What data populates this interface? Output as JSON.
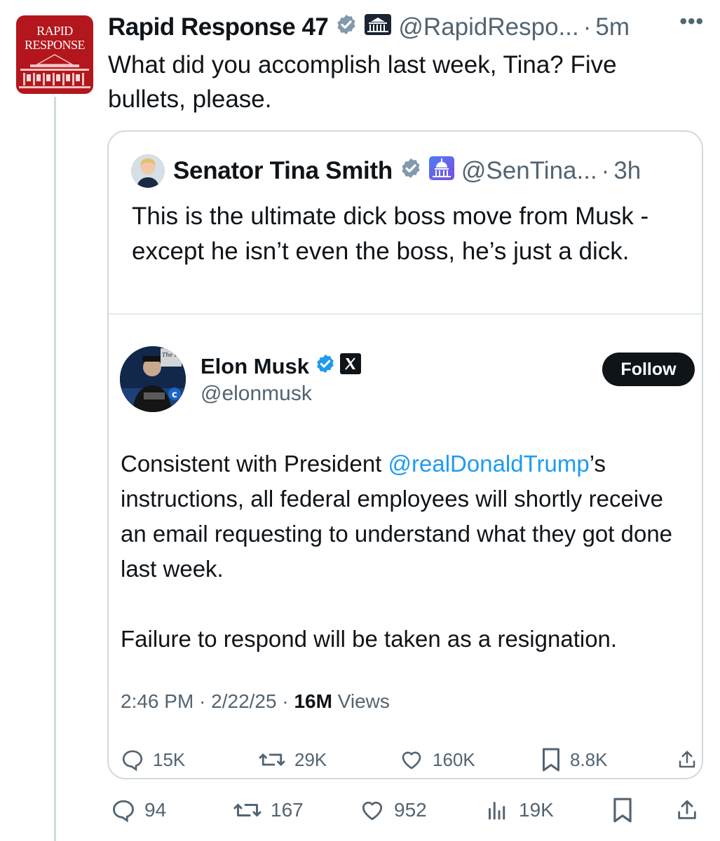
{
  "main_tweet": {
    "avatar_text": [
      "RAPID",
      "RESPONSE"
    ],
    "name": "Rapid Response 47",
    "handle": "@RapidRespo...",
    "time": "5m",
    "text": "What did you accomplish last week, Tina? Five bullets, please.",
    "badges": [
      "verified-badge-icon",
      "white-house-icon"
    ],
    "stats": {
      "replies": "94",
      "reposts": "167",
      "likes": "952",
      "views": "19K"
    }
  },
  "quote": {
    "name": "Senator Tina Smith",
    "handle": "@SenTina...",
    "time": "3h",
    "badges": [
      "verified-badge-icon",
      "capitol-icon"
    ],
    "text": "This is the ultimate dick boss move from Musk - except he isn’t even the boss, he’s just a dick."
  },
  "embedded": {
    "name": "Elon Musk",
    "handle": "@elonmusk",
    "follow_label": "Follow",
    "avatar_text": "The Rogers",
    "body_p1_pre": "Consistent with President ",
    "body_mention": "@realDonaldTrump",
    "body_p1_post": "’s instructions, all federal employees will shortly receive an email requesting to understand what they got done last week.",
    "body_p2": "Failure to respond will be taken as a resignation.",
    "meta_time": "2:46 PM · 2/22/25 · ",
    "meta_views": "16M",
    "meta_views_label": " Views",
    "stats": {
      "replies": "15K",
      "reposts": "29K",
      "likes": "160K",
      "bookmarks": "8.8K"
    }
  },
  "colors": {
    "accent": "#1d9bf0",
    "muted": "#536471",
    "rr_red": "#b3161c",
    "verified_gray": "#829aab"
  }
}
